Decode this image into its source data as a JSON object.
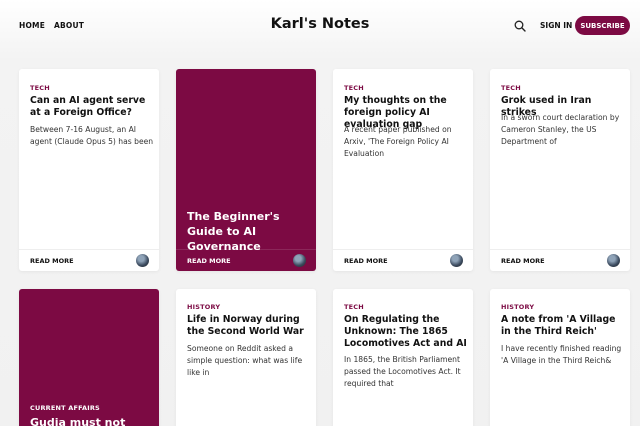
{
  "header": {
    "nav": [
      "HOME",
      "ABOUT"
    ],
    "site_title": "Karl's Notes",
    "search_icon": "search-icon",
    "sign_in": "SIGN IN",
    "subscribe": "SUBSCRIBE"
  },
  "colors": {
    "accent": "#7c0a43"
  },
  "cards": [
    {
      "tag": "TECH",
      "title": "Can an AI agent serve at a Foreign Office?",
      "excerpt": "Between 7-16 August, an AI agent (Claude Opus 5) has been",
      "read_more": "READ MORE"
    },
    {
      "tag": "",
      "title": "The Beginner's Guide to AI Governance",
      "excerpt": "",
      "read_more": "READ MORE"
    },
    {
      "tag": "TECH",
      "title": "My thoughts on the foreign policy AI evaluation gap",
      "excerpt": "A recent paper published on Arxiv, 'The Foreign Policy AI Evaluation",
      "read_more": "READ MORE"
    },
    {
      "tag": "TECH",
      "title": "Grok used in Iran strikes",
      "excerpt": "In a sworn court declaration by Cameron Stanley, the US Department of",
      "read_more": "READ MORE"
    },
    {
      "tag": "CURRENT AFFAIRS",
      "title": "Gudia must not",
      "excerpt": ""
    },
    {
      "tag": "HISTORY",
      "title": "Life in Norway during the Second World War",
      "excerpt": "Someone on Reddit asked a simple question: what was life like in"
    },
    {
      "tag": "TECH",
      "title": "On Regulating the Unknown: The 1865 Locomotives Act and AI",
      "excerpt": "In 1865, the British Parliament passed the Locomotives Act. It required that"
    },
    {
      "tag": "HISTORY",
      "title": "A note from 'A Village in the Third Reich'",
      "excerpt": "I have recently finished reading 'A Village in the Third Reich&"
    }
  ]
}
